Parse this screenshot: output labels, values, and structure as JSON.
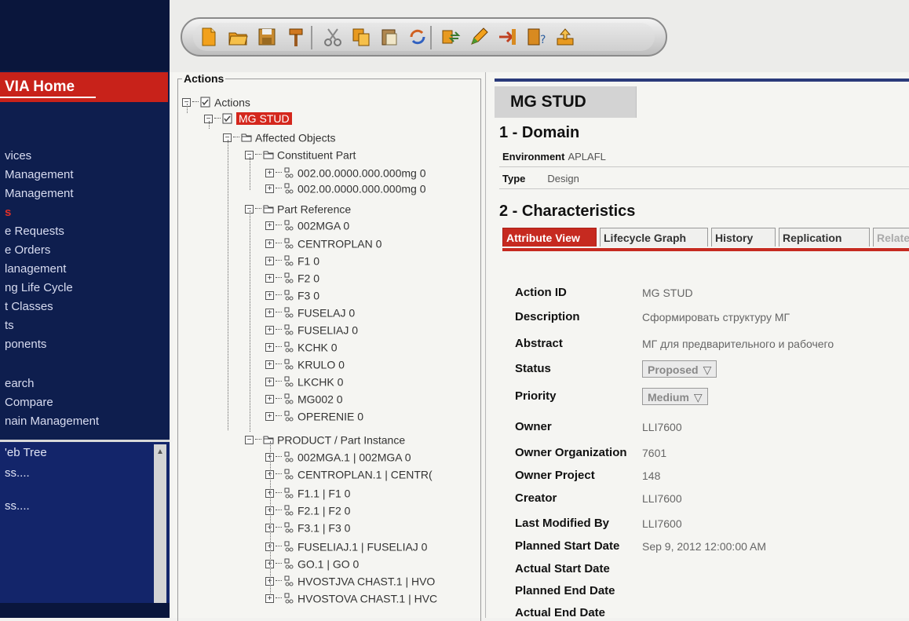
{
  "nav": {
    "home": "VIA Home",
    "items": [
      {
        "label": "vices",
        "highlight": false
      },
      {
        "label": "Management",
        "highlight": false
      },
      {
        "label": "Management",
        "highlight": false
      },
      {
        "label": "s",
        "highlight": true
      },
      {
        "label": "e Requests",
        "highlight": false
      },
      {
        "label": "e Orders",
        "highlight": false
      },
      {
        "label": "lanagement",
        "highlight": false
      },
      {
        "label": "ng Life Cycle",
        "highlight": false
      },
      {
        "label": "t Classes",
        "highlight": false
      },
      {
        "label": "ts",
        "highlight": false
      },
      {
        "label": "ponents",
        "highlight": false
      },
      {
        "label": "earch",
        "highlight": false
      },
      {
        "label": "Compare",
        "highlight": false
      },
      {
        "label": "nain Management",
        "highlight": false
      }
    ],
    "lower_items": [
      "'eb Tree",
      "ss....",
      "ss...."
    ]
  },
  "toolbar": {
    "icons": [
      "new-document-icon",
      "open-folder-icon",
      "save-icon",
      "hammer-icon",
      "cut-icon",
      "copy-icon",
      "paste-icon",
      "sync-icon",
      "transfer-icon",
      "edit-icon",
      "exit-icon",
      "help-icon",
      "upload-icon"
    ]
  },
  "tree": {
    "legend": "Actions",
    "nodes": [
      {
        "label": "Actions",
        "icon": "checkbox-icon",
        "exp": "−"
      },
      {
        "label": "MG STUD",
        "icon": "checkbox-icon",
        "exp": "−",
        "selected": true
      },
      {
        "label": "Affected Objects",
        "icon": "folder-icon",
        "exp": "−"
      },
      {
        "label": "Constituent Part",
        "icon": "folder-icon",
        "exp": "−"
      },
      {
        "label": "002.00.0000.000.000mg 0",
        "icon": "part-icon",
        "exp": "+"
      },
      {
        "label": "002.00.0000.000.000mg 0",
        "icon": "part-icon",
        "exp": "+"
      },
      {
        "label": "Part Reference",
        "icon": "folder-icon",
        "exp": "−"
      },
      {
        "label": "002MGA 0",
        "icon": "part-icon",
        "exp": "+"
      },
      {
        "label": "CENTROPLAN 0",
        "icon": "part-icon",
        "exp": "+"
      },
      {
        "label": "F1 0",
        "icon": "part-icon",
        "exp": "+"
      },
      {
        "label": "F2 0",
        "icon": "part-icon",
        "exp": "+"
      },
      {
        "label": "F3 0",
        "icon": "part-icon",
        "exp": "+"
      },
      {
        "label": "FUSELAJ 0",
        "icon": "part-icon",
        "exp": "+"
      },
      {
        "label": "FUSELIAJ 0",
        "icon": "part-icon",
        "exp": "+"
      },
      {
        "label": "KCHK 0",
        "icon": "part-icon",
        "exp": "+"
      },
      {
        "label": "KRULO 0",
        "icon": "part-icon",
        "exp": "+"
      },
      {
        "label": "LKCHK 0",
        "icon": "part-icon",
        "exp": "+"
      },
      {
        "label": "MG002 0",
        "icon": "part-icon",
        "exp": "+"
      },
      {
        "label": "OPERENIE 0",
        "icon": "part-icon",
        "exp": "+"
      },
      {
        "label": "PRODUCT / Part Instance",
        "icon": "folder-icon",
        "exp": "−"
      },
      {
        "label": "002MGA.1 | 002MGA 0",
        "icon": "part-icon",
        "exp": "+"
      },
      {
        "label": "CENTROPLAN.1 | CENTR(",
        "icon": "part-icon",
        "exp": "+"
      },
      {
        "label": "F1.1 | F1 0",
        "icon": "part-icon",
        "exp": "+"
      },
      {
        "label": "F2.1 | F2 0",
        "icon": "part-icon",
        "exp": "+"
      },
      {
        "label": "F3.1 | F3 0",
        "icon": "part-icon",
        "exp": "+"
      },
      {
        "label": "FUSELIAJ.1 | FUSELIAJ 0",
        "icon": "part-icon",
        "exp": "+"
      },
      {
        "label": "GO.1 | GO 0",
        "icon": "part-icon",
        "exp": "+"
      },
      {
        "label": "HVOSTJVA CHAST.1 | HVO",
        "icon": "part-icon",
        "exp": "+"
      },
      {
        "label": "HVOSTOVA CHAST.1 | HVC",
        "icon": "part-icon",
        "exp": "+"
      }
    ]
  },
  "detail": {
    "title": "MG STUD",
    "section1": "1 - Domain",
    "environment_label": "Environment",
    "environment_value": "APLAFL",
    "type_label": "Type",
    "type_value": "Design",
    "section2": "2 - Characteristics",
    "tabs": [
      {
        "label": "Attribute View",
        "state": "active"
      },
      {
        "label": "Lifecycle Graph",
        "state": "normal"
      },
      {
        "label": "History",
        "state": "normal"
      },
      {
        "label": "Replication",
        "state": "normal"
      },
      {
        "label": "Related",
        "state": "disabled"
      }
    ],
    "attributes": [
      {
        "label": "Action ID",
        "value": "MG STUD"
      },
      {
        "label": "Description",
        "value": "Сформировать структуру МГ"
      },
      {
        "label": "Abstract",
        "value": "МГ для предварительного и рабочего"
      },
      {
        "label": "Status",
        "value": "Proposed",
        "dropdown": true
      },
      {
        "label": "Priority",
        "value": "Medium",
        "dropdown": true
      },
      {
        "label": "Owner",
        "value": "LLI7600"
      },
      {
        "label": "Owner Organization",
        "value": "7601"
      },
      {
        "label": "Owner Project",
        "value": "148"
      },
      {
        "label": "Creator",
        "value": "LLI7600"
      },
      {
        "label": "Last Modified By",
        "value": "LLI7600"
      },
      {
        "label": "Planned Start Date",
        "value": "Sep 9, 2012 12:00:00 AM"
      },
      {
        "label": "Actual Start Date",
        "value": ""
      },
      {
        "label": "Planned End Date",
        "value": ""
      },
      {
        "label": "Actual End Date",
        "value": ""
      }
    ]
  },
  "colors": {
    "accent": "#c62a20",
    "nav_bg": "#0e1e4e",
    "selection": "#d4271d"
  }
}
